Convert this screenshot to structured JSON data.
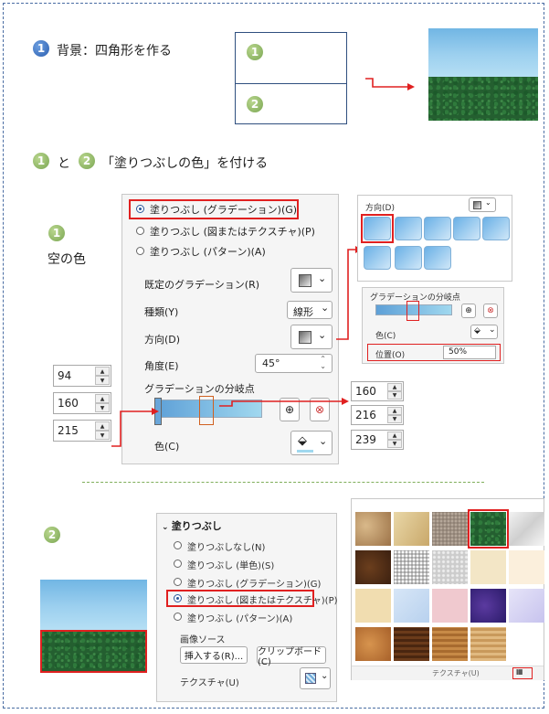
{
  "section1": {
    "num": "1",
    "title": "背景：四角形を作る"
  },
  "diagram": {
    "top_num": "1",
    "bottom_num": "2"
  },
  "section2": {
    "num1": "1",
    "conj": "と",
    "num2": "2",
    "title": "「塗りつぶしの色」を付ける"
  },
  "sky": {
    "num": "1",
    "label": "空の色"
  },
  "fill_panel": {
    "opt_gradient": "塗りつぶし (グラデーション)(G)",
    "opt_picture": "塗りつぶし (図またはテクスチャ)(P)",
    "opt_pattern": "塗りつぶし (パターン)(A)",
    "preset_label": "既定のグラデーション(R)",
    "type_label": "種類(Y)",
    "type_value": "線形",
    "direction_label": "方向(D)",
    "angle_label": "角度(E)",
    "angle_value": "45°",
    "stops_label": "グラデーションの分岐点",
    "color_label": "色(C)"
  },
  "direction_popup": {
    "title": "方向(D)"
  },
  "stop_popup": {
    "title": "グラデーションの分岐点",
    "color_label": "色(C)",
    "position_label": "位置(O)",
    "position_value": "50%"
  },
  "rgb_left": [
    "94",
    "160",
    "215"
  ],
  "rgb_right": [
    "160",
    "216",
    "239"
  ],
  "section3": {
    "num": "2"
  },
  "fill_panel2": {
    "header": "塗りつぶし",
    "opt_none": "塗りつぶしなし(N)",
    "opt_solid": "塗りつぶし (単色)(S)",
    "opt_gradient": "塗りつぶし (グラデーション)(G)",
    "opt_picture": "塗りつぶし (図またはテクスチャ)(P)",
    "opt_pattern": "塗りつぶし (パターン)(A)",
    "source_label": "画像ソース",
    "insert_button": "挿入する(R)...",
    "clipboard_button": "クリップボード(C)",
    "texture_label": "テクスチャ(U)"
  },
  "texture_gallery": {
    "footer": "テクスチャ(U)"
  },
  "colors": {
    "accent_red": "#e02020",
    "frame_blue": "#4a6da3",
    "circle_blue": "#2c5fb0",
    "circle_green": "#7aa652"
  }
}
